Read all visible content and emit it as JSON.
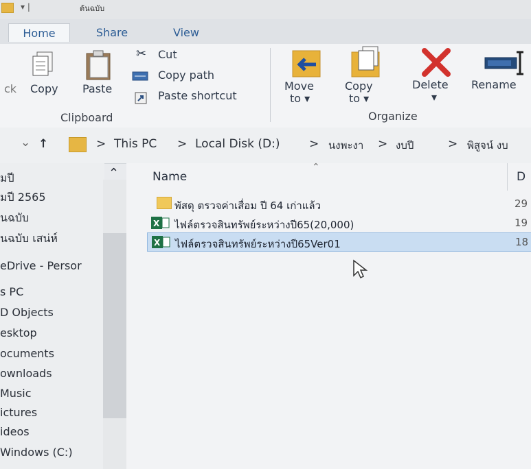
{
  "titlebar": {
    "quick_access": "▾ |",
    "title": "ต้นฉบับ"
  },
  "tabs": [
    {
      "label": "Home"
    },
    {
      "label": "Share"
    },
    {
      "label": "View"
    }
  ],
  "ribbon": {
    "clipboard": {
      "cut_partial": "ck",
      "copy": "Copy",
      "paste": "Paste",
      "cut": "Cut",
      "copy_path": "Copy path",
      "paste_shortcut": "Paste shortcut",
      "group_label": "Clipboard"
    },
    "organize": {
      "move_to": "Move",
      "move_to_2": "to ▾",
      "copy_to": "Copy",
      "copy_to_2": "to ▾",
      "delete": "Delete",
      "delete_2": "▾",
      "rename": "Rename",
      "group_label": "Organize"
    }
  },
  "address": {
    "back": "⌄",
    "up": "↑",
    "crumbs": [
      "This PC",
      "Local Disk (D:)",
      "นงพะงา",
      "งบปี",
      "พิสูจน์ งบ"
    ],
    "sep": ">"
  },
  "sidebar": {
    "items": [
      "มปี",
      "มปี 2565",
      "นฉบับ",
      "นฉบับ เสน่ห์",
      "eDrive - Persor",
      "s PC",
      "D Objects",
      "esktop",
      "ocuments",
      "ownloads",
      "Music",
      "ictures",
      "ideos",
      "Windows (C:)"
    ]
  },
  "content": {
    "col_name": "Name",
    "col_date": "D",
    "files": [
      {
        "name": "พัสดุ ตรวจค่าเสื่อม ปี 64 เก่าแล้ว",
        "type": "folder",
        "date": "29"
      },
      {
        "name": "ไฟล์ตรวจสินทรัพย์ระหว่างปี65(20,000)",
        "type": "excel",
        "date": "19"
      },
      {
        "name": "ไฟล์ตรวจสินทรัพย์ระหว่างปี65Ver01",
        "type": "excel",
        "date": "18",
        "selected": true
      }
    ]
  },
  "colors": {
    "accent": "#2d5d95",
    "selection": "#c9ddf2",
    "folder": "#e6b644",
    "excel": "#1e7145",
    "delete_red": "#d2322d"
  }
}
